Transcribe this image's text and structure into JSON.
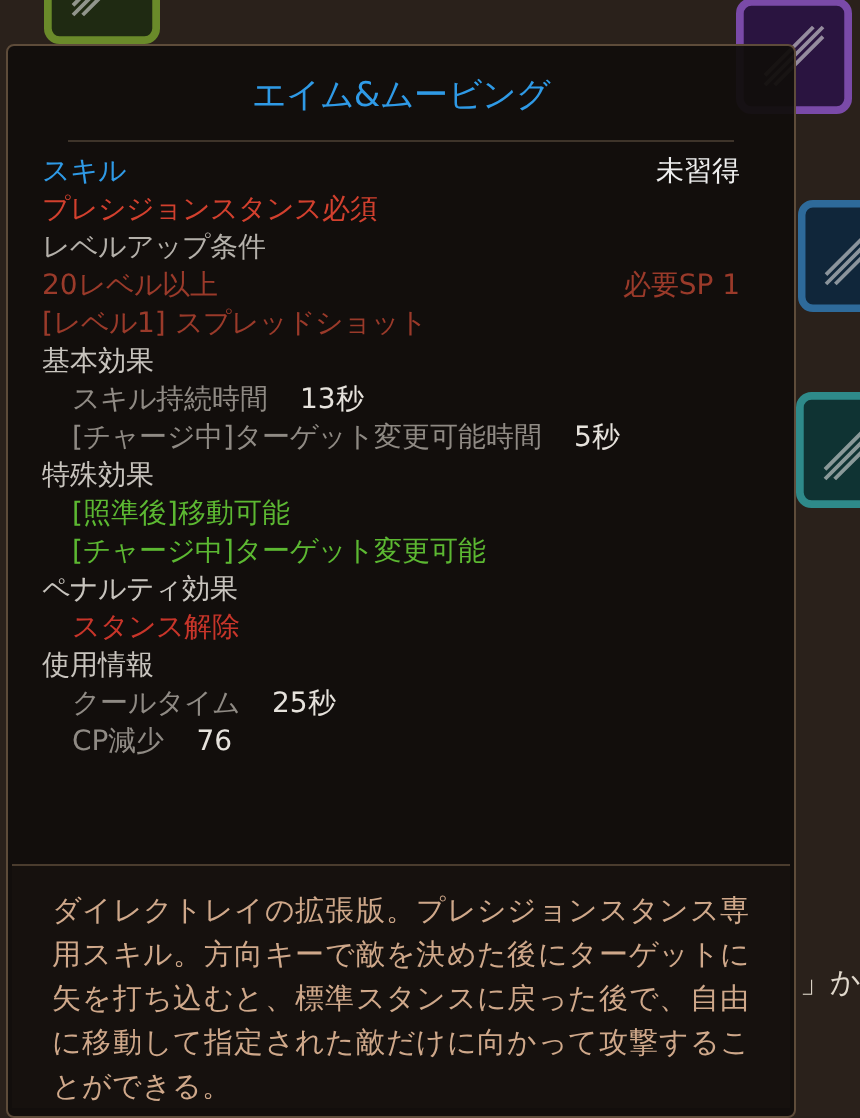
{
  "tooltip": {
    "title": "エイム&ムービング",
    "skill_type": {
      "label": "スキル",
      "status": "未習得"
    },
    "requirement": "プレシジョンスタンス必須",
    "level_up": {
      "heading": "レベルアップ条件",
      "conditions": [
        {
          "text": "20レベル以上",
          "note": "必要SP 1"
        },
        {
          "text": "[レベル1] スプレッドショット"
        }
      ]
    },
    "sections": [
      {
        "heading": "基本効果",
        "items": [
          {
            "kind": "stat",
            "name": "スキル持続時間",
            "value": "13秒"
          },
          {
            "kind": "stat",
            "name": "[チャージ中]ターゲット変更可能時間",
            "value": "5秒"
          }
        ]
      },
      {
        "heading": "特殊効果",
        "items": [
          {
            "kind": "bonus",
            "name": "[照準後]移動可能"
          },
          {
            "kind": "bonus",
            "name": "[チャージ中]ターゲット変更可能"
          }
        ]
      },
      {
        "heading": "ペナルティ効果",
        "items": [
          {
            "kind": "penalty",
            "name": "スタンス解除"
          }
        ]
      },
      {
        "heading": "使用情報",
        "items": [
          {
            "kind": "stat",
            "name": "クールタイム",
            "value": "25秒"
          },
          {
            "kind": "stat",
            "name": "CP減少",
            "value": "76"
          }
        ]
      }
    ],
    "description": "ダイレクトレイの拡張版。プレシジョンスタンス専用スキル。方向キーで敵を決めた後にターゲットに矢を打ち込むと、標準スタンスに戻った後で、自由に移動して指定された敵だけに向かって攻撃することができる。"
  },
  "background": {
    "side_text": "」か"
  }
}
